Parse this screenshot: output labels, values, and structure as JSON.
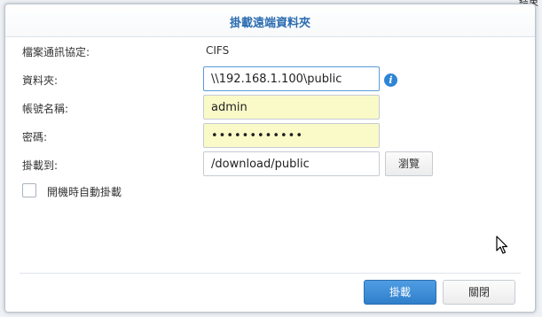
{
  "corner_text": "結束",
  "dialog": {
    "title": "掛載遠端資料夾",
    "protocol": {
      "label": "檔案通訊協定:",
      "value": "CIFS"
    },
    "folder": {
      "label": "資料夾:",
      "value": "\\\\192.168.1.100\\public"
    },
    "account": {
      "label": "帳號名稱:",
      "value": "admin"
    },
    "password": {
      "label": "密碼:",
      "value": "••••••••••••"
    },
    "mount_to": {
      "label": "掛載到:",
      "value": "/download/public"
    },
    "browse_label": "瀏覽",
    "auto_mount": {
      "label": "開機時自動掛載",
      "checked": false
    },
    "mount_button": "掛載",
    "close_button": "關閉"
  },
  "colors": {
    "title": "#2a6cb0",
    "required_field": "#fafac8",
    "primary_button": "#3b8ad6",
    "info_icon": "#2e85d6"
  },
  "icons": {
    "info": "info-icon",
    "cursor": "mouse-pointer-icon"
  }
}
